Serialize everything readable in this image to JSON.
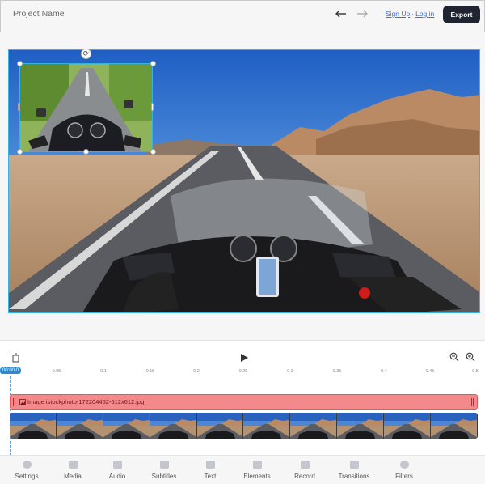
{
  "header": {
    "project_name": "Project Name",
    "sign_up": "Sign Up",
    "separator": "·",
    "log_in": "Log in",
    "export_label": "Export"
  },
  "timeline": {
    "current_time": "00:00.0",
    "ticks": [
      "0.05",
      "0.1",
      "0.15",
      "0.2",
      "0.25",
      "0.3",
      "0.35",
      "0.4",
      "0.45",
      "0.5"
    ],
    "image_track_label": "Image istockphoto-172204452-612x612.jpg",
    "video_thumbnails": 10
  },
  "toolbar": {
    "items": [
      {
        "label": "Settings",
        "icon": "gear-icon"
      },
      {
        "label": "Media",
        "icon": "media-icon"
      },
      {
        "label": "Audio",
        "icon": "music-icon"
      },
      {
        "label": "Subtitles",
        "icon": "subtitles-icon"
      },
      {
        "label": "Text",
        "icon": "text-icon"
      },
      {
        "label": "Elements",
        "icon": "elements-icon"
      },
      {
        "label": "Record",
        "icon": "record-icon"
      },
      {
        "label": "Transitions",
        "icon": "transitions-icon"
      },
      {
        "label": "Filters",
        "icon": "filters-icon"
      }
    ]
  },
  "colors": {
    "accent": "#35b3e3",
    "export_bg": "#1f2430",
    "link": "#3a6fd6",
    "image_track": "#f28a8c"
  }
}
